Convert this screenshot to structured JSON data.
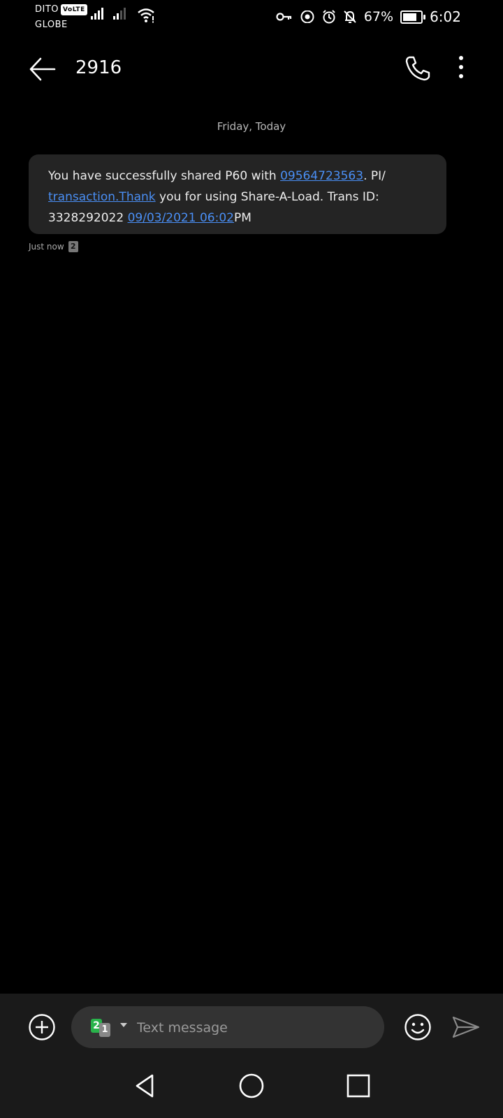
{
  "status_bar": {
    "carrier_1": "DITO",
    "volte_badge": "VoLTE",
    "carrier_2": "GLOBE",
    "battery_percent": "67%",
    "battery_level": 0.67,
    "time": "6:02"
  },
  "app_bar": {
    "contact_name": "2916"
  },
  "thread": {
    "date_separator": "Friday, Today",
    "message": {
      "text_1": "You have successfully shared P60 with ",
      "link_phone": "09564723563",
      "text_2": ". PI/",
      "link_transaction": "transaction.Thank",
      "text_3": " you for using Share-A-Load. Trans ID: 3328292022 ",
      "link_datetime": "09/03/2021 06:02",
      "text_4": "PM"
    },
    "timestamp": "Just now",
    "sim_slot": "2"
  },
  "composer": {
    "sim_primary": "2",
    "sim_secondary": "1",
    "placeholder": "Text message"
  },
  "icons": {
    "back": "arrow-left-icon",
    "call": "phone-icon",
    "more": "more-vertical-icon",
    "attach": "plus-circle-icon",
    "emoji": "smiley-icon",
    "send": "send-icon",
    "nav_back": "triangle-back-icon",
    "nav_home": "circle-home-icon",
    "nav_recents": "square-recents-icon"
  },
  "colors": {
    "background": "#000000",
    "bubble": "#242424",
    "link": "#4a8ff5",
    "sim2_badge": "#29b34b"
  }
}
